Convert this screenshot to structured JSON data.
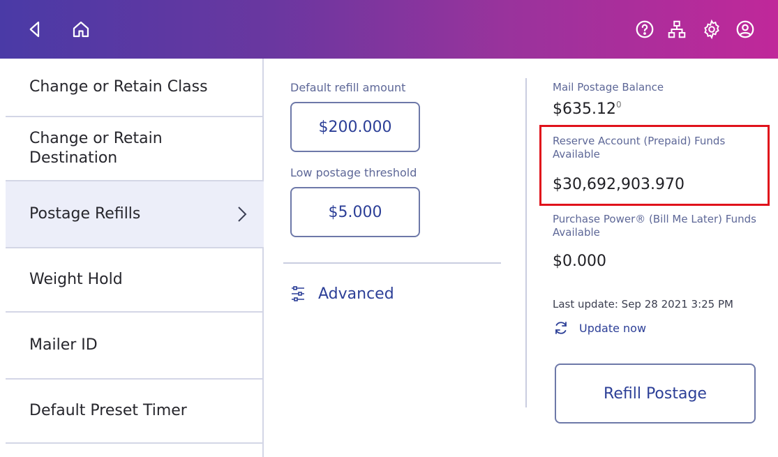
{
  "topbar": {
    "left_icons": [
      "back-icon",
      "home-icon"
    ],
    "right_icons": [
      "help-icon",
      "network-icon",
      "settings-icon",
      "account-icon"
    ]
  },
  "sidebar": {
    "items": [
      {
        "label": "Change or Retain Class"
      },
      {
        "label": "Change or Retain\nDestination"
      },
      {
        "label": "Postage Refills",
        "active": true
      },
      {
        "label": "Weight Hold"
      },
      {
        "label": "Mailer ID"
      },
      {
        "label": "Default Preset Timer"
      }
    ]
  },
  "refill": {
    "default_amount_label": "Default refill amount",
    "default_amount_value": "$200.000",
    "threshold_label": "Low postage threshold",
    "threshold_value": "$5.000",
    "advanced_label": "Advanced"
  },
  "balances": {
    "mail_postage_label": "Mail Postage Balance",
    "mail_postage_value": "$635.12",
    "mail_postage_superscript": "0",
    "reserve_label": "Reserve Account (Prepaid) Funds Available",
    "reserve_value": "$30,692,903.970",
    "purchase_power_label": "Purchase Power® (Bill Me Later) Funds Available",
    "purchase_power_value": "$0.000",
    "last_update": "Last update: Sep 28 2021 3:25 PM",
    "update_now": "Update now",
    "refill_button": "Refill Postage"
  },
  "colors": {
    "accent": "#2c3f97",
    "highlight": "#e0121b",
    "header_start": "#4a3aa6",
    "header_end": "#c0289a"
  }
}
